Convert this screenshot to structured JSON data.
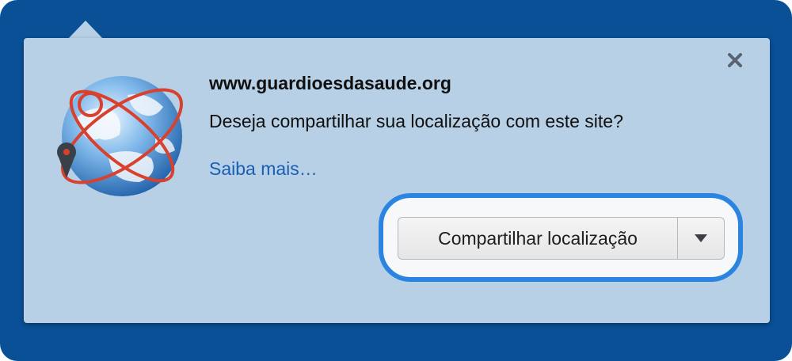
{
  "prompt": {
    "site": "www.guardioesdasaude.org",
    "question": "Deseja compartilhar sua localização com este site?",
    "learn_more": "Saiba mais…",
    "share_button_label": "Compartilhar localização"
  },
  "icons": {
    "close": "close-icon",
    "globe": "globe-location-icon",
    "dropdown": "triangle-down-icon"
  },
  "colors": {
    "outer_background": "#0a5096",
    "panel_background": "#b8d0e6",
    "link": "#1a5fb4",
    "focus_ring": "#2a84e0"
  }
}
